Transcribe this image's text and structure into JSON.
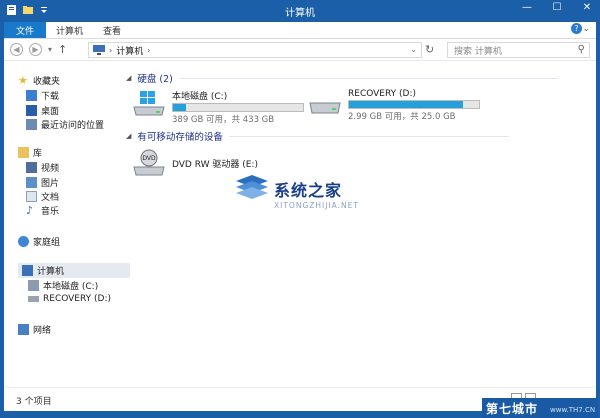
{
  "window": {
    "title": "计算机",
    "controls": {
      "minimize": "—",
      "maximize": "☐",
      "close": "✕"
    }
  },
  "ribbon": {
    "tabs": [
      "文件",
      "计算机",
      "查看"
    ],
    "expand": "⌄",
    "help": "?"
  },
  "address": {
    "path": "计算机",
    "search_placeholder": "搜索 计算机"
  },
  "sidebar": {
    "favorites": {
      "label": "收藏夹",
      "items": [
        "下载",
        "桌面",
        "最近访问的位置"
      ]
    },
    "libraries": {
      "label": "库",
      "items": [
        "视频",
        "图片",
        "文档",
        "音乐"
      ]
    },
    "homegroup": "家庭组",
    "computer": {
      "label": "计算机",
      "items": [
        "本地磁盘 (C:)",
        "RECOVERY (D:)"
      ]
    },
    "network": "网络"
  },
  "main": {
    "hard_disks": {
      "header": "硬盘 (2)",
      "drives": [
        {
          "name": "本地磁盘 (C:)",
          "free": "389 GB 可用，共 433 GB",
          "used_fraction": 0.1
        },
        {
          "name": "RECOVERY (D:)",
          "free": "2.99 GB 可用，共 25.0 GB",
          "used_fraction": 0.88
        }
      ]
    },
    "removable": {
      "header": "有可移动存储的设备",
      "devices": [
        {
          "name": "DVD RW 驱动器 (E:)",
          "badge": "DVD"
        }
      ]
    }
  },
  "watermark": {
    "name": "系统之家",
    "url": "XITONGZHIJIA.NET"
  },
  "status": {
    "count": "3 个项目"
  },
  "corner_logo": {
    "name": "第七城市",
    "url": "www.TH7.CN"
  },
  "colors": {
    "titlebar": "#1b5fa8",
    "file_tab": "#1979ca",
    "progress": "#26a0da",
    "group_header": "#1e3287"
  }
}
